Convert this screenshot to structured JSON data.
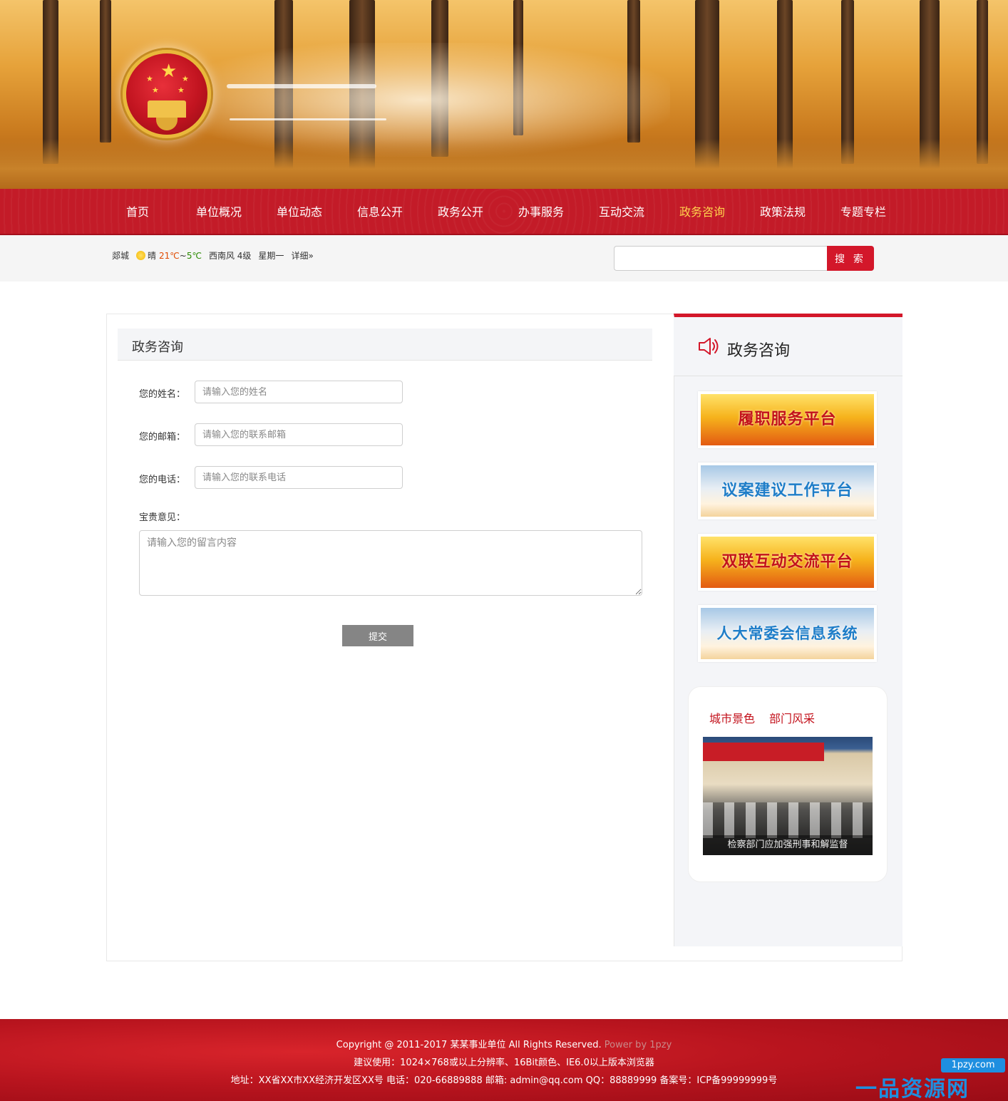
{
  "nav": {
    "items": [
      "首页",
      "单位概况",
      "单位动态",
      "信息公开",
      "政务公开",
      "办事服务",
      "互动交流",
      "政务咨询",
      "政策法规",
      "专题专栏"
    ],
    "active": "政务咨询"
  },
  "weather": {
    "city": "郯城",
    "condition": "晴",
    "temp_high": "21℃",
    "sep": "~",
    "temp_low": "5℃",
    "wind": "西南风 4级",
    "weekday": "星期一",
    "detail_link": "详细»"
  },
  "search": {
    "placeholder": "",
    "button_label": "搜 索"
  },
  "form": {
    "heading": "政务咨询",
    "name_label": "您的姓名：",
    "name_placeholder": "请输入您的姓名",
    "email_label": "您的邮箱：",
    "email_placeholder": "请输入您的联系邮箱",
    "phone_label": "您的电话：",
    "phone_placeholder": "请输入您的联系电话",
    "opinion_label": "宝贵意见：",
    "opinion_placeholder": "请输入您的留言内容",
    "submit_label": "提交"
  },
  "sidebar": {
    "title": "政务咨询",
    "promos": [
      "履职服务平台",
      "议案建议工作平台",
      "双联互动交流平台",
      "人大常委会信息系统"
    ],
    "tabs": [
      "城市景色",
      "部门风采"
    ],
    "photo_caption": "检察部门应加强刑事和解监督"
  },
  "footer": {
    "copyright": "Copyright @ 2011-2017 某某事业单位 All Rights Reserved.",
    "powered": "Power by 1pzy",
    "advice": "建议使用：1024×768或以上分辨率、16Bit颜色、IE6.0以上版本浏览器",
    "address": "地址：XX省XX市XX经济开发区XX号 电话：020-66889888 邮箱: admin@qq.com QQ：88889999 备案号：ICP备99999999号"
  },
  "watermark": {
    "url": "1pzy.com",
    "text": "一品资源网"
  },
  "colors": {
    "brand_red": "#c31b28",
    "active_nav": "#ffd34d",
    "search_button": "#d3172a",
    "submit_button": "#858585"
  }
}
